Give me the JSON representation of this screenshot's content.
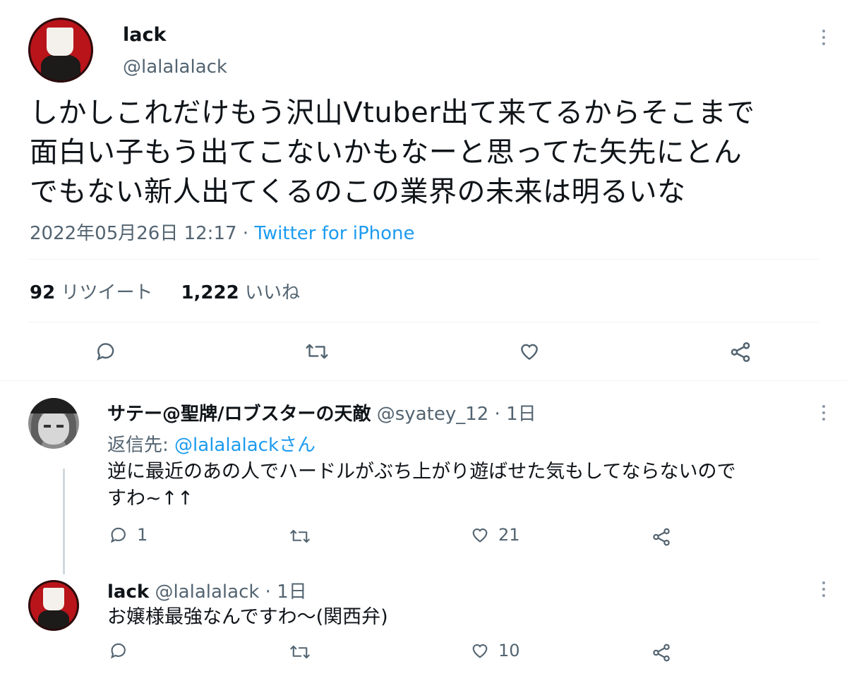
{
  "main_tweet": {
    "display_name": "lack",
    "handle": "@lalalalack",
    "text": "しかしこれだけもう沢山Vtuber出て来てるからそこまで面白い子もう出てこないかもなーと思ってた矢先にとんでもない新人出てくるのこの業界の未来は明るいな",
    "text_lines": [
      "しかしこれだけもう沢山Vtuber出て来てるからそこまで",
      "面白い子もう出てこないかもなーと思ってた矢先にとん",
      "でもない新人出てくるのこの業界の未来は明るいな"
    ],
    "timestamp": "2022年05月26日 12:17",
    "separator": " · ",
    "source": "Twitter for iPhone",
    "retweet_count": "92",
    "retweet_label": "リツイート",
    "like_count": "1,222",
    "like_label": "いいね"
  },
  "replies": [
    {
      "display_name": "サテー@聖牌/ロブスターの天敵",
      "handle": "@syatey_12",
      "time": "1日",
      "reply_to_label": "返信先: ",
      "reply_to_handle": "@lalalalackさん",
      "text_lines": [
        "逆に最近のあの人でハードルがぶち上がり遊ばせた気もしてならないので",
        "すわ~↑↑"
      ],
      "reply_count": "1",
      "retweet_count": "",
      "like_count": "21"
    },
    {
      "display_name": "lack",
      "handle": "@lalalalack",
      "time": "1日",
      "text_lines": [
        "お嬢様最強なんですわ〜(関西弁)"
      ],
      "reply_count": "",
      "retweet_count": "",
      "like_count": "10"
    }
  ],
  "icons": {
    "reply": "reply-icon",
    "retweet": "retweet-icon",
    "like": "heart-icon",
    "share": "share-icon",
    "more": "more-icon"
  },
  "colors": {
    "text": "#0f1419",
    "secondary": "#536471",
    "link": "#1d9bf0",
    "divider": "#eff3f4"
  }
}
